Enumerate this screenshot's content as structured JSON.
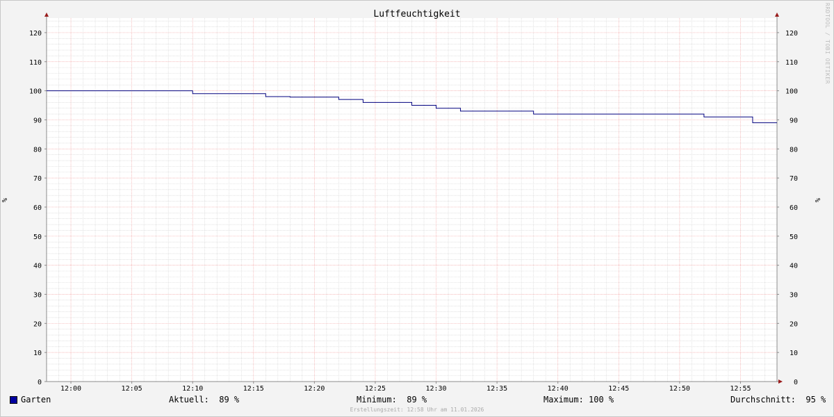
{
  "watermark": "RRDTOOL / TOBI OETIKER",
  "chart_data": {
    "type": "line",
    "title": "Luftfeuchtigkeit",
    "ylabel": "%",
    "ylabel_right": "%",
    "ylim": [
      0,
      125
    ],
    "yticks": [
      0,
      10,
      20,
      30,
      40,
      50,
      60,
      70,
      80,
      90,
      100,
      110,
      120
    ],
    "xlim": [
      "11:58",
      "12:58"
    ],
    "xticks": [
      "12:00",
      "12:05",
      "12:10",
      "12:15",
      "12:20",
      "12:25",
      "12:30",
      "12:35",
      "12:40",
      "12:45",
      "12:50",
      "12:55"
    ],
    "grid": true,
    "colors": {
      "series": "#00007f",
      "major_grid": "#f4a4a4",
      "minor_grid": "#cfcfcf",
      "axis": "#8c8c8c",
      "arrow": "#991b1b",
      "plot_bg": "#ffffff"
    },
    "series": [
      {
        "name": "Garten",
        "step": true,
        "points": [
          [
            "11:58",
            100
          ],
          [
            "12:10",
            99
          ],
          [
            "12:16",
            98
          ],
          [
            "12:18",
            97.8
          ],
          [
            "12:22",
            97
          ],
          [
            "12:24",
            96
          ],
          [
            "12:28",
            95
          ],
          [
            "12:30",
            94
          ],
          [
            "12:32",
            93
          ],
          [
            "12:38",
            92
          ],
          [
            "12:52",
            91
          ],
          [
            "12:56",
            89
          ],
          [
            "12:58",
            89
          ]
        ]
      }
    ]
  },
  "legend": {
    "name": "Garten",
    "current": "Aktuell:  89 %",
    "minimum": "Minimum:  89 %",
    "maximum": "Maximum: 100 %",
    "average": "Durchschnitt:  95 %",
    "swatch_color": "#0000a0"
  },
  "footer": "Erstellungszeit: 12:58 Uhr am 11.01.2026"
}
